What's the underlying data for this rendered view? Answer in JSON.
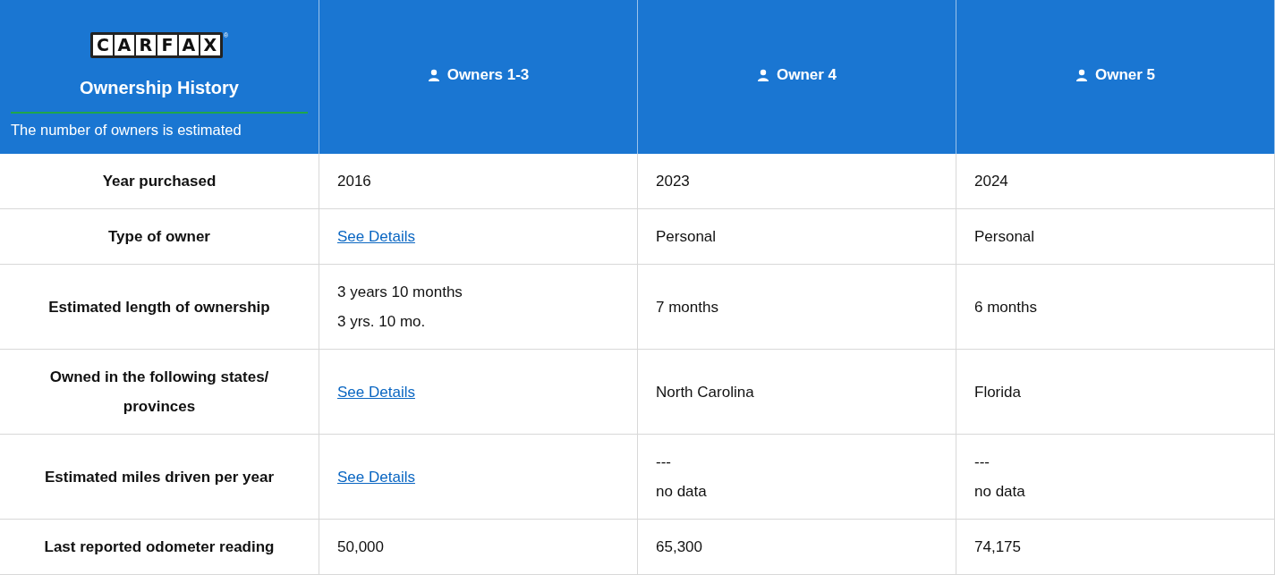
{
  "header": {
    "logo": {
      "letters": [
        "C",
        "A",
        "R",
        "F",
        "A",
        "X"
      ],
      "mark": "®"
    },
    "title": "Ownership History",
    "note": "The number of owners is estimated",
    "columns": [
      "Owners 1-3",
      "Owner 4",
      "Owner 5"
    ]
  },
  "rows": [
    {
      "label": "Year purchased",
      "cells": [
        {
          "kind": "text",
          "lines": [
            "2016"
          ]
        },
        {
          "kind": "text",
          "lines": [
            "2023"
          ]
        },
        {
          "kind": "text",
          "lines": [
            "2024"
          ]
        }
      ]
    },
    {
      "label": "Type of owner",
      "cells": [
        {
          "kind": "link",
          "lines": [
            "See Details"
          ]
        },
        {
          "kind": "text",
          "lines": [
            "Personal"
          ]
        },
        {
          "kind": "text",
          "lines": [
            "Personal"
          ]
        }
      ]
    },
    {
      "label": "Estimated length of ownership",
      "cells": [
        {
          "kind": "text",
          "lines": [
            "3 years 10 months",
            "3 yrs. 10 mo."
          ]
        },
        {
          "kind": "text",
          "lines": [
            "7 months"
          ]
        },
        {
          "kind": "text",
          "lines": [
            "6 months"
          ]
        }
      ]
    },
    {
      "label": "Owned in the following states/ provinces",
      "cells": [
        {
          "kind": "link",
          "lines": [
            "See Details"
          ]
        },
        {
          "kind": "text",
          "lines": [
            "North Carolina"
          ]
        },
        {
          "kind": "text",
          "lines": [
            "Florida"
          ]
        }
      ]
    },
    {
      "label": "Estimated miles driven per year",
      "cells": [
        {
          "kind": "link",
          "lines": [
            "See Details"
          ]
        },
        {
          "kind": "text",
          "lines": [
            "---",
            "no data"
          ]
        },
        {
          "kind": "text",
          "lines": [
            "---",
            "no data"
          ]
        }
      ]
    },
    {
      "label": "Last reported odometer reading",
      "cells": [
        {
          "kind": "text",
          "lines": [
            "50,000"
          ]
        },
        {
          "kind": "text",
          "lines": [
            "65,300"
          ]
        },
        {
          "kind": "text",
          "lines": [
            "74,175"
          ]
        }
      ]
    }
  ]
}
